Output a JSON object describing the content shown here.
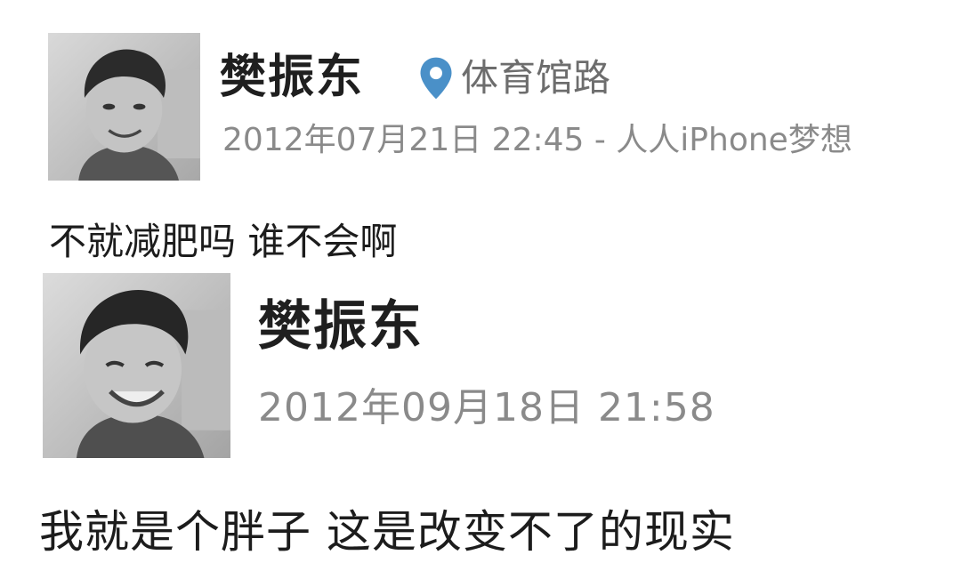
{
  "posts": [
    {
      "author": "樊振东",
      "location": "体育馆路",
      "meta": "2012年07月21日 22:45 - 人人iPhone梦想",
      "content": "不就减肥吗 谁不会啊",
      "icons": {
        "avatar": "avatar-photo",
        "location": "location-pin-icon"
      },
      "colors": {
        "location_pin": "#4a90c8"
      }
    },
    {
      "author": "樊振东",
      "meta": "2012年09月18日 21:58",
      "content": "我就是个胖子 这是改变不了的现实",
      "icons": {
        "avatar": "avatar-photo"
      }
    }
  ]
}
